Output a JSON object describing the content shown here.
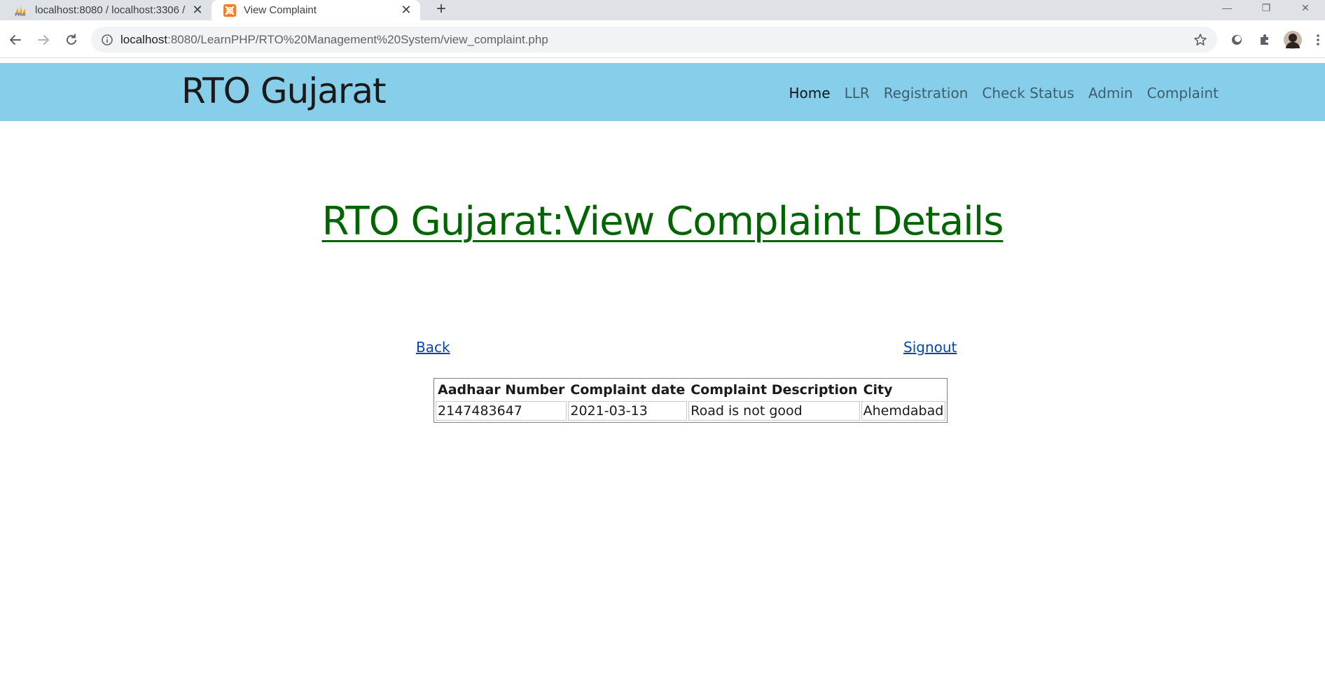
{
  "browser": {
    "tabs": [
      {
        "title": "localhost:8080 / localhost:3306 /",
        "icon": "phpmyadmin-icon",
        "active": false
      },
      {
        "title": "View Complaint",
        "icon": "xampp-icon",
        "active": true
      }
    ],
    "url_host": "localhost",
    "url_path": ":8080/LearnPHP/RTO%20Management%20System/view_complaint.php"
  },
  "site": {
    "brand": "RTO Gujarat",
    "nav": [
      {
        "label": "Home",
        "current": true
      },
      {
        "label": "LLR",
        "current": false
      },
      {
        "label": "Registration",
        "current": false
      },
      {
        "label": "Check Status",
        "current": false
      },
      {
        "label": "Admin",
        "current": false
      },
      {
        "label": "Complaint",
        "current": false
      }
    ],
    "nav_bg_color": "#87ceeb"
  },
  "main": {
    "heading": "RTO Gujarat:View Complaint Details",
    "heading_color": "#006400",
    "back_label": "Back",
    "signout_label": "Signout",
    "table": {
      "headers": [
        "Aadhaar Number",
        "Complaint date",
        "Complaint Description",
        "City"
      ],
      "rows": [
        [
          "2147483647",
          "2021-03-13",
          "Road is not good",
          "Ahemdabad"
        ]
      ]
    }
  }
}
